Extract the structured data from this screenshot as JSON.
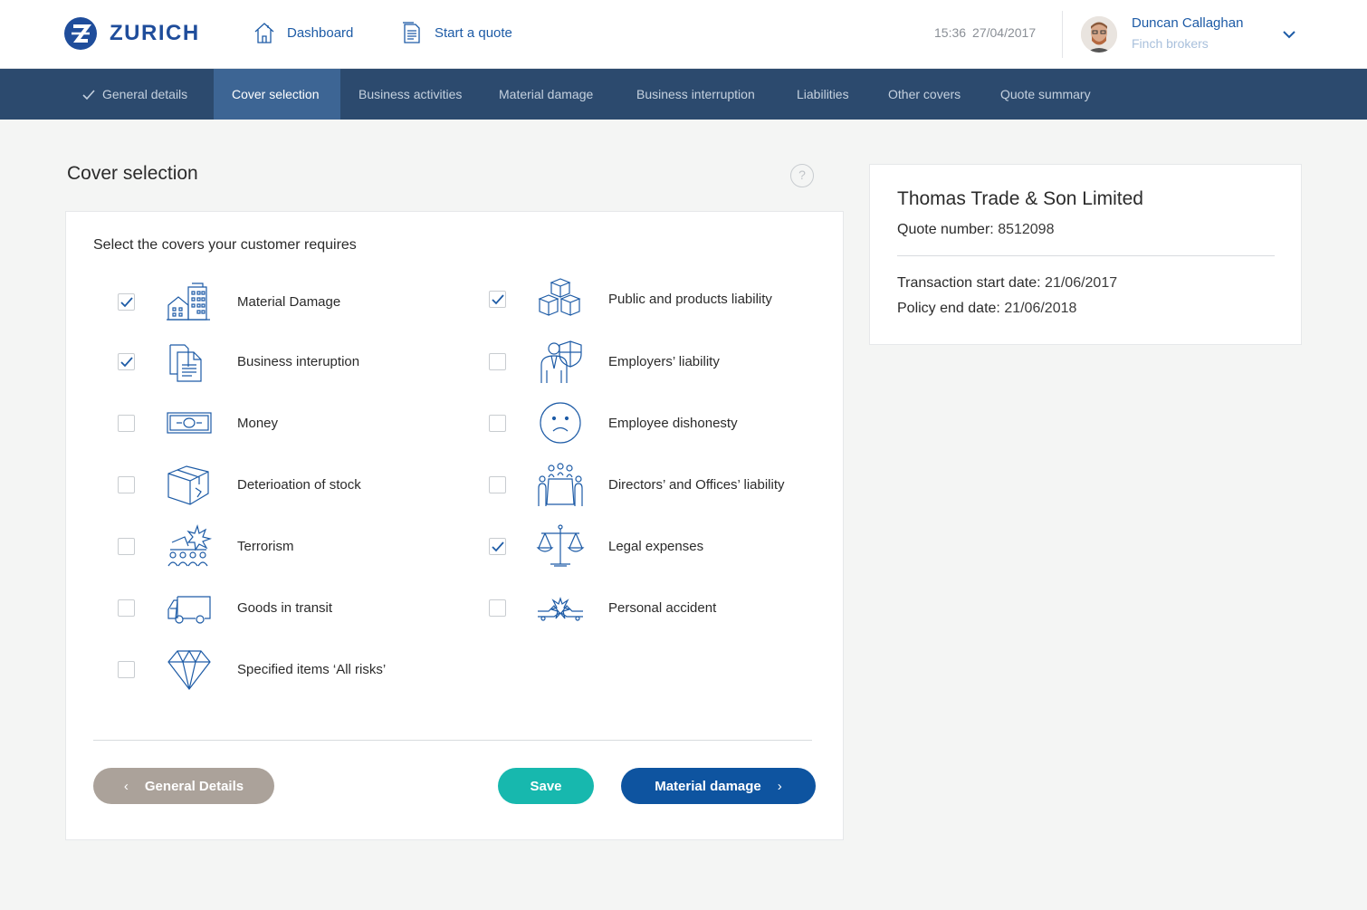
{
  "brand": {
    "name": "ZURICH",
    "color": "#1f4d9b"
  },
  "header": {
    "nav": [
      {
        "label": "Dashboard",
        "icon": "home-icon"
      },
      {
        "label": "Start a quote",
        "icon": "document-icon"
      }
    ],
    "time": "15:36",
    "date": "27/04/2017",
    "user": {
      "name": "Duncan Callaghan",
      "org": "Finch brokers"
    }
  },
  "steps": [
    {
      "label": "General details",
      "state": "done"
    },
    {
      "label": "Cover selection",
      "state": "active"
    },
    {
      "label": "Business activities",
      "state": "todo"
    },
    {
      "label": "Material damage",
      "state": "todo"
    },
    {
      "label": "Business interruption",
      "state": "todo"
    },
    {
      "label": "Liabilities",
      "state": "todo"
    },
    {
      "label": "Other covers",
      "state": "todo"
    },
    {
      "label": "Quote summary",
      "state": "todo"
    }
  ],
  "page": {
    "title": "Cover selection",
    "help": "?"
  },
  "covers": {
    "intro": "Select the covers your customer requires",
    "left": [
      {
        "label": "Material Damage",
        "checked": true,
        "icon": "buildings-icon"
      },
      {
        "label": "Business interuption",
        "checked": true,
        "icon": "documents-icon"
      },
      {
        "label": "Money",
        "checked": false,
        "icon": "banknote-icon"
      },
      {
        "label": "Deterioation of stock",
        "checked": false,
        "icon": "damaged-box-icon"
      },
      {
        "label": "Terrorism",
        "checked": false,
        "icon": "explosion-crowd-icon"
      },
      {
        "label": "Goods in transit",
        "checked": false,
        "icon": "van-icon"
      },
      {
        "label": "Specified items ‘All risks’",
        "checked": false,
        "icon": "diamond-icon"
      }
    ],
    "right": [
      {
        "label": "Public and products liability",
        "checked": true,
        "icon": "boxes-icon"
      },
      {
        "label": "Employers’ liability",
        "checked": false,
        "icon": "employee-shield-icon"
      },
      {
        "label": "Employee dishonesty",
        "checked": false,
        "icon": "sad-face-icon"
      },
      {
        "label": "Directors’ and Offices’ liability",
        "checked": false,
        "icon": "boardroom-icon"
      },
      {
        "label": "Legal expenses",
        "checked": true,
        "icon": "scales-icon"
      },
      {
        "label": "Personal accident",
        "checked": false,
        "icon": "car-crash-icon"
      }
    ]
  },
  "actions": {
    "back": "General Details",
    "save": "Save",
    "next": "Material damage"
  },
  "summary": {
    "company": "Thomas Trade & Son Limited",
    "quote_label": "Quote number:",
    "quote_value": "8512098",
    "start_label": "Transaction start date:",
    "start_value": "21/06/2017",
    "end_label": "Policy end date:",
    "end_value": "21/06/2018"
  },
  "colors": {
    "nav_bg": "#2c4a6e",
    "nav_active": "#3d6594",
    "link": "#1d5ba6",
    "save": "#17b8ae",
    "next": "#0e54a0",
    "back": "#aba29a"
  }
}
